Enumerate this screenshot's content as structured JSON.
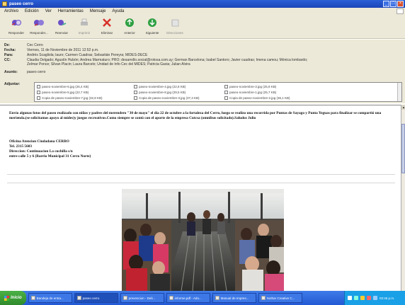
{
  "window": {
    "title": "paseo cerro"
  },
  "menu": [
    "Archivo",
    "Edición",
    "Ver",
    "Herramientas",
    "Mensaje",
    "Ayuda"
  ],
  "toolbar": [
    {
      "label": "Responder",
      "icon": "reply-icon",
      "color": "#6a4fc8"
    },
    {
      "label": "Responder...",
      "icon": "reply-all-icon",
      "color": "#6a4fc8"
    },
    {
      "label": "Reenviar",
      "icon": "forward-icon",
      "color": "#6a4fc8"
    },
    {
      "label": "Imprimir",
      "icon": "print-icon",
      "color": "#9a9a9a"
    },
    {
      "label": "Eliminar",
      "icon": "delete-icon",
      "color": "#d7322a"
    },
    {
      "label": "Anterior",
      "icon": "previous-icon",
      "color": "#2ea043"
    },
    {
      "label": "Siguiente",
      "icon": "next-icon",
      "color": "#2ea043"
    },
    {
      "label": "Direcciones",
      "icon": "addresses-icon",
      "color": "#a8a8a8"
    }
  ],
  "header": {
    "de_label": "De:",
    "de": "Cec Cerro",
    "fecha_label": "Fecha:",
    "fecha": "Viernes, 11 de Noviembre de 2011 12:52 p.m.",
    "para_label": "Para:",
    "para": "Andrés Scagliola; lauro; Carmen Cuadras; Sebastián Pereyra; MIDES-DECE",
    "cc_label": "CC:",
    "cc": "Claudia Delgado; Agustín Hubón; Andrea Marmaturo; PRO; desarrollo.social@rotosa.com.uy; German Barcelona; Isabel Santoro; Javier cuadras; Imena camou; Mónica lombardo;",
    "cc2": "Zelmar Ponce; Silvan Placin; Laura Barcelo; Unidad de Info Cec del MIDES; Patricia Gaxia; Julian Alvira",
    "asunto_label": "Asunto:",
    "asunto": "paseo cerro",
    "adjuntar_label": "Adjuntar:",
    "attachments": [
      "paseo-noviembre-6.jpg (26,4 KB)",
      "paseo-noviembre-4.jpg (22,8 KB)",
      "paseo-noviembre-3.jpg (25,9 KB)",
      "paseo-noviembre-5.jpg (22,7 KB)",
      "paseo-noviembre-8.jpg (29,5 KB)",
      "paseo-noviembre-1.jpg (25,7 KB)",
      "Copia de paseo-noviembre-7.jpg (32,8 KB)",
      "Copia de paseo-noviembre-3.jpg (37,3 KB)",
      "Copia de paseo-noviembre-2.jpg (36,1 KB)"
    ]
  },
  "message": {
    "body": "Envío algunas fotos del paseo realizado con niños y padres del merendero \"30 de mayo\" el día 22 de octubre a la fortaleza del Cerro, luego se realizo una recorrida por Puntas de Sayago y Punta Yeguas para finalizar se compartió una merienda.(se solicitamos apoyo al mides)y juegos recreativos.Como siempre se contó con el aporte de la empresa Cutcsa (omnibus solicitado).Saludos Julio",
    "sig1": "Oficina Atencion Ciudadana CERRO",
    "sig2": "Tel. 2315 5603",
    "sig3": "Direccion: Continuacion La cuchilla s/n",
    "sig4": "entre calle 5 y 6 (Barrio Municipal 31 Cerro Norte)"
  },
  "taskbar": {
    "start": "Inicio",
    "tasks": [
      "Bandeja de entra...",
      "paseo cerro",
      "prevencion - Deli...",
      "informe.pdf - Ado...",
      "Manual de Impres...",
      "Nothar Creative C..."
    ],
    "clock": "03:46 p.m."
  }
}
